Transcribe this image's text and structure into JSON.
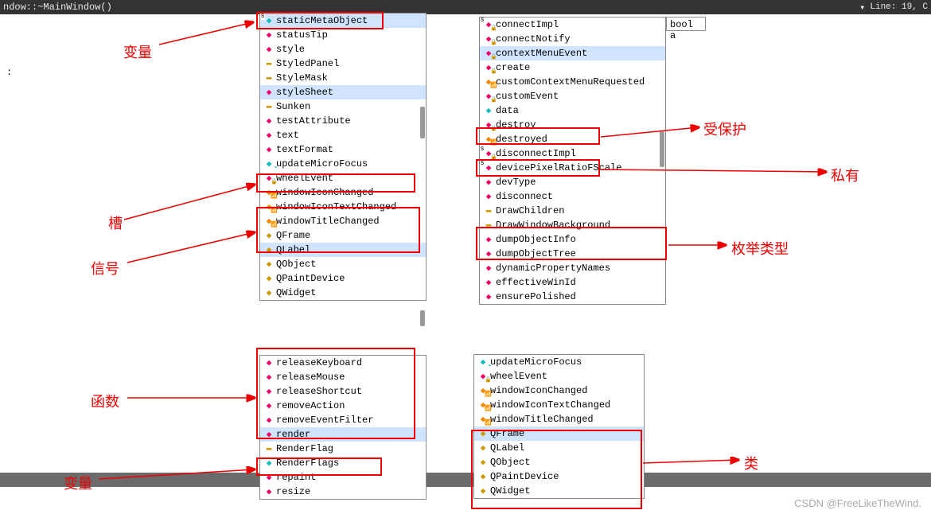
{
  "title_left": "ndow::~MainWindow()",
  "title_right": "Line: 19, C",
  "tooltip": "bool a",
  "colon": ":",
  "watermark": "CSDN @FreeLikeTheWind.",
  "labels": {
    "bianliang1": "变量",
    "cao": "槽",
    "xinhao": "信号",
    "hanshu": "函数",
    "bianliang2": "变量",
    "shoubaohu": "受保护",
    "siyou": "私有",
    "meiju": "枚举类型",
    "lei": "类"
  },
  "popups": {
    "a": [
      {
        "t": "staticMetaObject",
        "i": "var",
        "s": true,
        "b": "S"
      },
      {
        "t": "statusTip",
        "i": "fn"
      },
      {
        "t": "style",
        "i": "fn"
      },
      {
        "t": "StyledPanel",
        "i": "enum"
      },
      {
        "t": "StyleMask",
        "i": "enum"
      },
      {
        "t": "styleSheet",
        "i": "fn",
        "s": true
      },
      {
        "t": "Sunken",
        "i": "enum"
      },
      {
        "t": "testAttribute",
        "i": "fn"
      },
      {
        "t": "text",
        "i": "fn"
      },
      {
        "t": "textFormat",
        "i": "fn"
      },
      {
        "t": "updateMicroFocus",
        "i": "slot"
      },
      {
        "t": "wheelEvent",
        "i": "prot"
      },
      {
        "t": "windowIconChanged",
        "i": "signal"
      },
      {
        "t": "windowIconTextChanged",
        "i": "signal"
      },
      {
        "t": "windowTitleChanged",
        "i": "signal"
      },
      {
        "t": "QFrame",
        "i": "class"
      },
      {
        "t": "QLabel",
        "i": "class",
        "s": true
      },
      {
        "t": "QObject",
        "i": "class"
      },
      {
        "t": "QPaintDevice",
        "i": "class"
      },
      {
        "t": "QWidget",
        "i": "class"
      }
    ],
    "b": [
      {
        "t": "releaseKeyboard",
        "i": "fn"
      },
      {
        "t": "releaseMouse",
        "i": "fn"
      },
      {
        "t": "releaseShortcut",
        "i": "fn"
      },
      {
        "t": "removeAction",
        "i": "fn"
      },
      {
        "t": "removeEventFilter",
        "i": "fn"
      },
      {
        "t": "render",
        "i": "fn",
        "s": true
      },
      {
        "t": "RenderFlag",
        "i": "enum"
      },
      {
        "t": "RenderFlags",
        "i": "var"
      },
      {
        "t": "repaint",
        "i": "fn"
      },
      {
        "t": "resize",
        "i": "fn"
      }
    ],
    "c": [
      {
        "t": "connectImpl",
        "i": "priv",
        "b": "S"
      },
      {
        "t": "connectNotify",
        "i": "prot"
      },
      {
        "t": "contextMenuEvent",
        "i": "prot",
        "s": true
      },
      {
        "t": "create",
        "i": "prot"
      },
      {
        "t": "customContextMenuRequested",
        "i": "signal"
      },
      {
        "t": "customEvent",
        "i": "prot"
      },
      {
        "t": "data",
        "i": "var"
      },
      {
        "t": "destroy",
        "i": "prot"
      },
      {
        "t": "destroyed",
        "i": "signal"
      },
      {
        "t": "disconnectImpl",
        "i": "priv",
        "b": "S"
      },
      {
        "t": "devicePixelRatioFScale",
        "i": "fn",
        "b": "S"
      },
      {
        "t": "devType",
        "i": "fn"
      },
      {
        "t": "disconnect",
        "i": "fn"
      },
      {
        "t": "DrawChildren",
        "i": "enum"
      },
      {
        "t": "DrawWindowBackground",
        "i": "enum"
      },
      {
        "t": "dumpObjectInfo",
        "i": "fn"
      },
      {
        "t": "dumpObjectTree",
        "i": "fn"
      },
      {
        "t": "dynamicPropertyNames",
        "i": "fn"
      },
      {
        "t": "effectiveWinId",
        "i": "fn"
      },
      {
        "t": "ensurePolished",
        "i": "fn"
      }
    ],
    "d": [
      {
        "t": "updateMicroFocus",
        "i": "slot"
      },
      {
        "t": "wheelEvent",
        "i": "prot"
      },
      {
        "t": "windowIconChanged",
        "i": "signal"
      },
      {
        "t": "windowIconTextChanged",
        "i": "signal"
      },
      {
        "t": "windowTitleChanged",
        "i": "signal"
      },
      {
        "t": "QFrame",
        "i": "class",
        "s": true
      },
      {
        "t": "QLabel",
        "i": "class"
      },
      {
        "t": "QObject",
        "i": "class"
      },
      {
        "t": "QPaintDevice",
        "i": "class"
      },
      {
        "t": "QWidget",
        "i": "class"
      }
    ]
  }
}
